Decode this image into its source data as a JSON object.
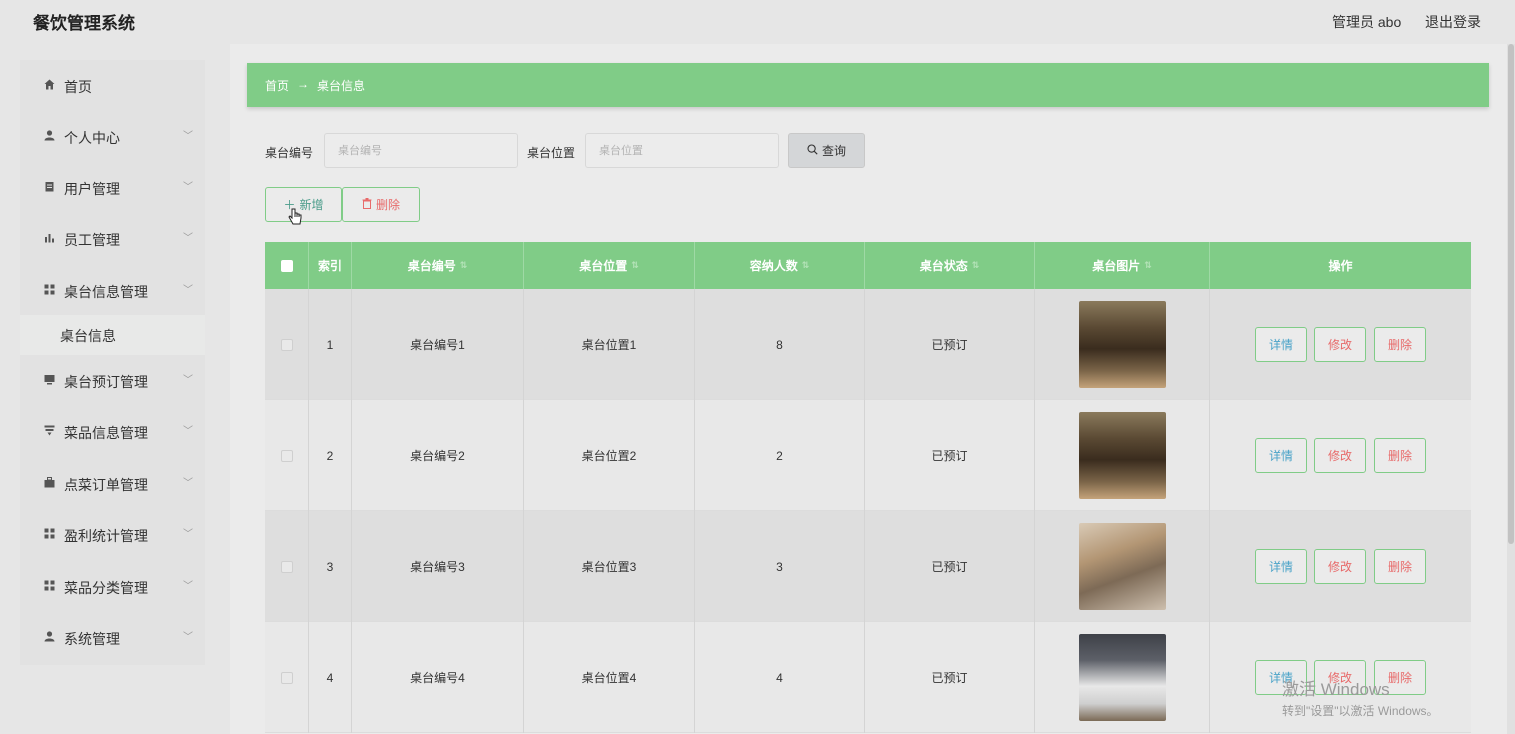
{
  "app": {
    "title": "餐饮管理系统"
  },
  "header": {
    "admin_label": "管理员 abo",
    "logout_label": "退出登录"
  },
  "sidebar": {
    "items": [
      {
        "label": "首页",
        "icon": "home-icon",
        "has_children": false
      },
      {
        "label": "个人中心",
        "icon": "user-icon",
        "has_children": true
      },
      {
        "label": "用户管理",
        "icon": "clipboard-icon",
        "has_children": true
      },
      {
        "label": "员工管理",
        "icon": "bar-chart-icon",
        "has_children": true
      },
      {
        "label": "桌台信息管理",
        "icon": "grid-icon",
        "has_children": true,
        "expanded": true
      },
      {
        "label": "桌台预订管理",
        "icon": "monitor-icon",
        "has_children": true
      },
      {
        "label": "菜品信息管理",
        "icon": "filter-icon",
        "has_children": true
      },
      {
        "label": "点菜订单管理",
        "icon": "briefcase-icon",
        "has_children": true
      },
      {
        "label": "盈利统计管理",
        "icon": "grid-icon",
        "has_children": true
      },
      {
        "label": "菜品分类管理",
        "icon": "grid-icon",
        "has_children": true
      },
      {
        "label": "系统管理",
        "icon": "user-icon",
        "has_children": true
      }
    ],
    "active_subitem": "桌台信息"
  },
  "breadcrumb": {
    "home": "首页",
    "separator": "→",
    "current": "桌台信息"
  },
  "search": {
    "fields": [
      {
        "label": "桌台编号",
        "placeholder": "桌台编号",
        "value": ""
      },
      {
        "label": "桌台位置",
        "placeholder": "桌台位置",
        "value": ""
      }
    ],
    "query_label": "查询"
  },
  "toolbar": {
    "add_label": "新增",
    "delete_label": "删除"
  },
  "table": {
    "columns": [
      "索引",
      "桌台编号",
      "桌台位置",
      "容纳人数",
      "桌台状态",
      "桌台图片",
      "操作"
    ],
    "sortable": [
      false,
      true,
      true,
      true,
      true,
      true,
      false
    ],
    "rows": [
      {
        "index": "1",
        "code": "桌台编号1",
        "location": "桌台位置1",
        "capacity": "8",
        "status": "已预订",
        "image": "restaurant-dining-photo"
      },
      {
        "index": "2",
        "code": "桌台编号2",
        "location": "桌台位置2",
        "capacity": "2",
        "status": "已预订",
        "image": "restaurant-dining-photo"
      },
      {
        "index": "3",
        "code": "桌台编号3",
        "location": "桌台位置3",
        "capacity": "3",
        "status": "已预订",
        "image": "wooden-table-photo"
      },
      {
        "index": "4",
        "code": "桌台编号4",
        "location": "桌台位置4",
        "capacity": "4",
        "status": "已预订",
        "image": "cafeteria-photo"
      }
    ],
    "actions": {
      "detail": "详情",
      "edit": "修改",
      "delete": "删除"
    }
  },
  "watermark": {
    "line1": "激活 Windows",
    "line2": "转到\"设置\"以激活 Windows。"
  },
  "colors": {
    "accent": "#80cc87",
    "danger": "#e86a6a",
    "info": "#4aa3c8",
    "background": "#ebebeb"
  }
}
